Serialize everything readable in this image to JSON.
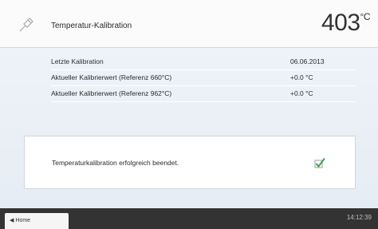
{
  "header": {
    "title": "Temperatur-Kalibration",
    "temperature": "403",
    "unit": "°C"
  },
  "rows": [
    {
      "label": "Letzte Kalibration",
      "value": "06.06.2013"
    },
    {
      "label": "Aktueller Kalibrierwert (Referenz 660°C)",
      "value": "+0.0 °C"
    },
    {
      "label": "Aktueller Kalibrierwert (Referenz 962°C)",
      "value": "+0.0 °C"
    }
  ],
  "message": {
    "text": "Temperaturkalibration erfolgreich beendet."
  },
  "footer": {
    "home_label": "Home",
    "time": "14:12:39"
  },
  "icons": {
    "header": "pin-icon",
    "status": "checkmark-icon",
    "home": "arrow-left-icon"
  },
  "colors": {
    "check": "#3fa34d",
    "footer": "#333333"
  }
}
